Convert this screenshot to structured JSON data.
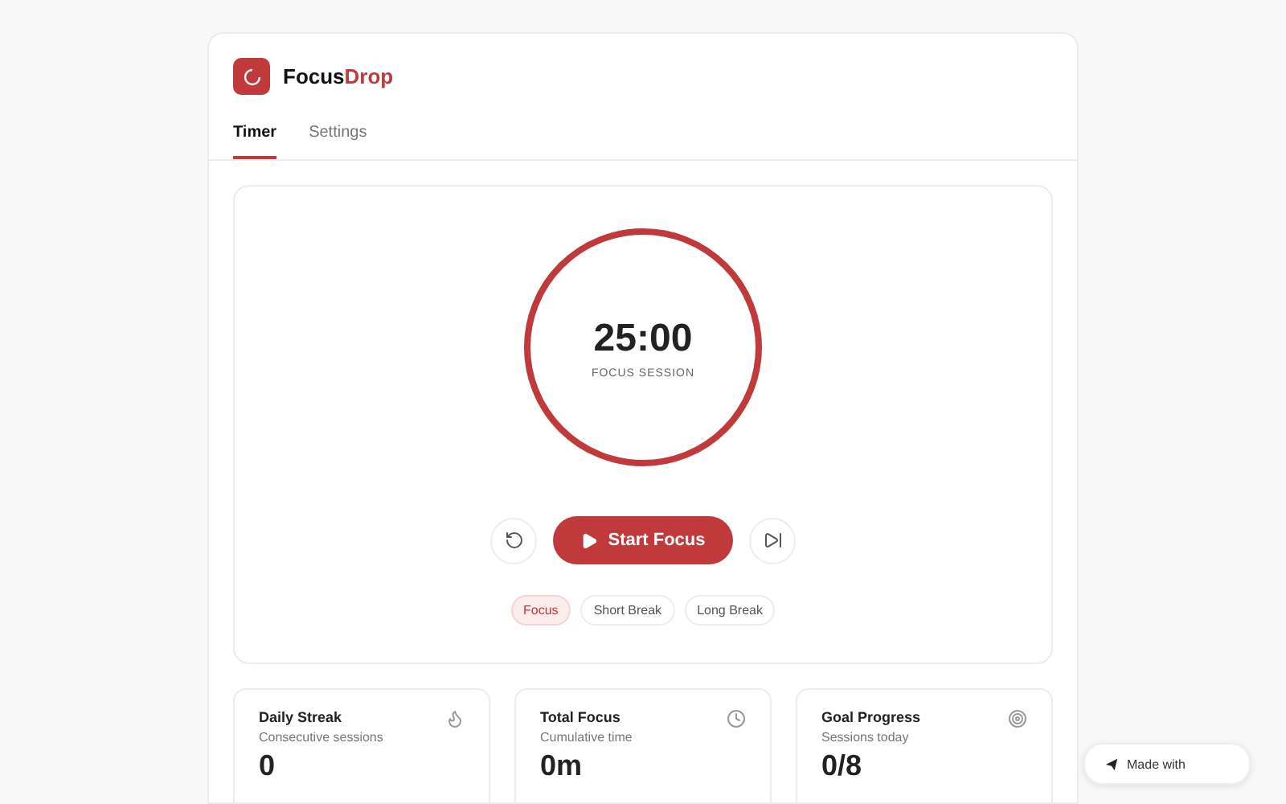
{
  "app": {
    "name": "Focus",
    "name_accent": "Drop"
  },
  "tabs": [
    {
      "label": "Timer",
      "selected": true
    },
    {
      "label": "Settings",
      "selected": false
    }
  ],
  "timer": {
    "time": "25:00",
    "caption": "FOCUS SESSION",
    "level": 1,
    "start_label": "Start Focus"
  },
  "modes": [
    {
      "label": "Focus",
      "selected": true
    },
    {
      "label": "Short Break",
      "selected": false
    },
    {
      "label": "Long Break",
      "selected": false
    }
  ],
  "stats": [
    {
      "title": "Daily Streak",
      "subtitle": "Consecutive sessions",
      "value": "0",
      "kind": "flame"
    },
    {
      "title": "Total Focus",
      "subtitle": "Cumulative time",
      "value": "0m",
      "kind": "clock"
    },
    {
      "title": "Goal Progress",
      "subtitle": "Sessions today",
      "value": "0/8",
      "kind": "target"
    }
  ],
  "badge": {
    "label": "Made with"
  }
}
